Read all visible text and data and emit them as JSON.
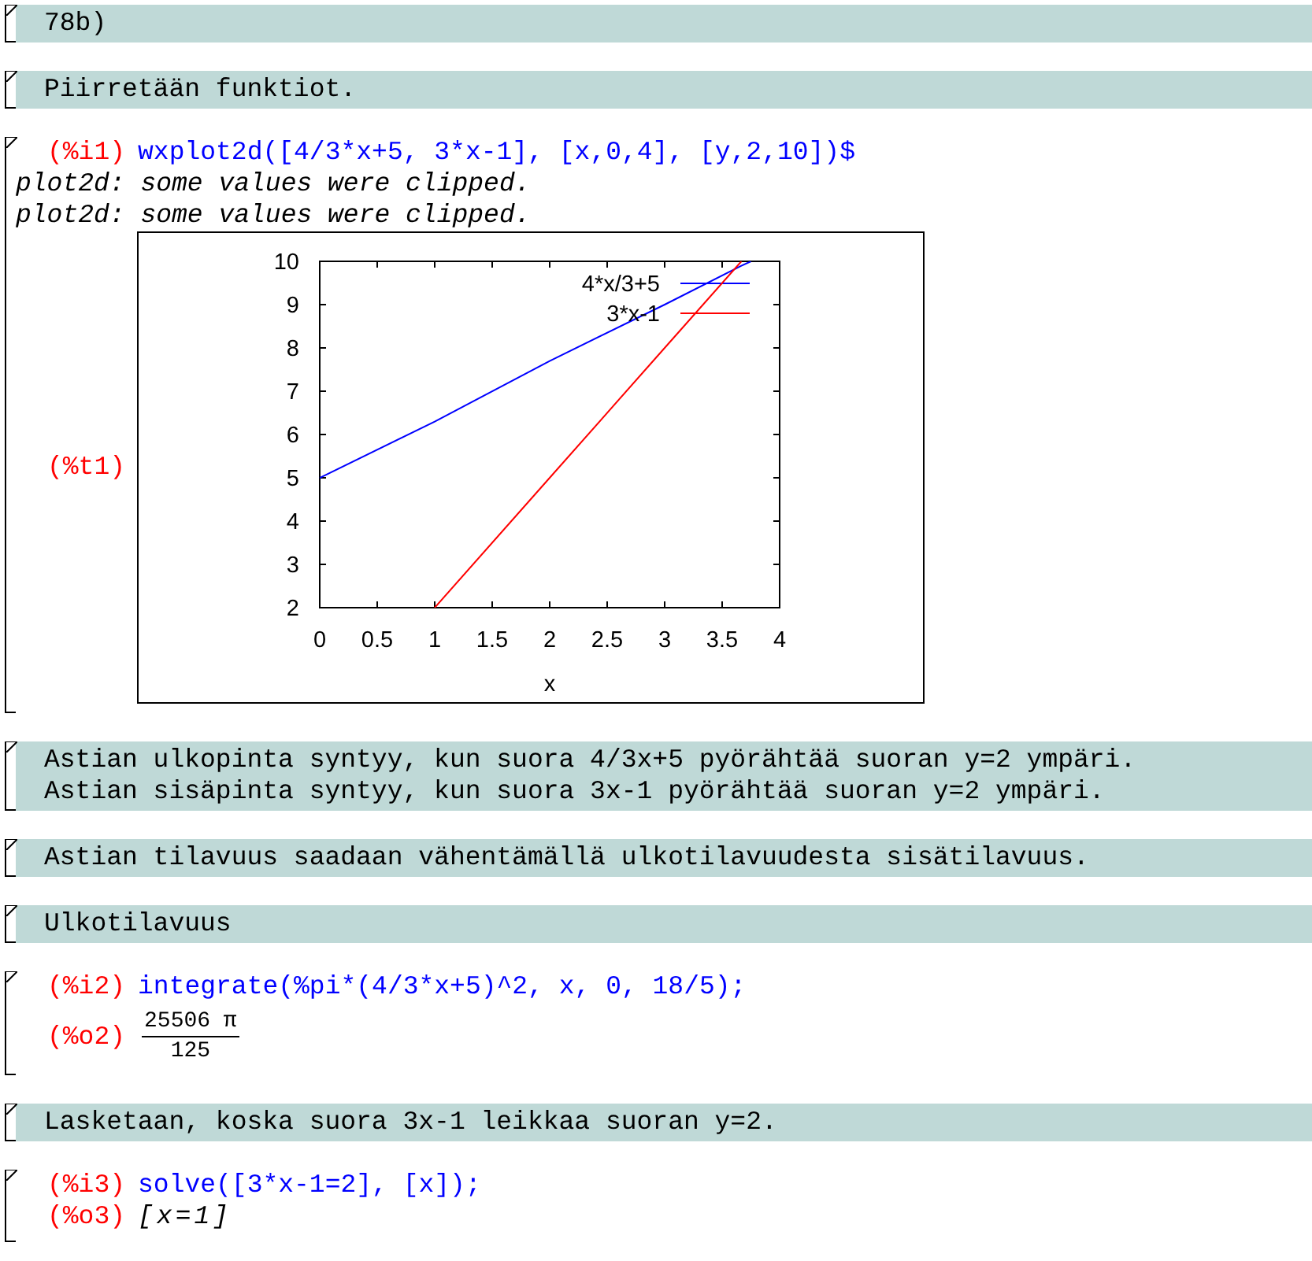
{
  "cells": [
    {
      "kind": "text",
      "lines": [
        "78b)"
      ]
    },
    {
      "kind": "text",
      "lines": [
        "Piirretään funktiot."
      ]
    },
    {
      "kind": "code",
      "label": "(%i1)",
      "input": "wxplot2d([4/3*x+5, 3*x-1], [x,0,4], [y,2,10])$",
      "outputs": [
        {
          "kind": "message",
          "text": "plot2d: some values were clipped."
        },
        {
          "kind": "message",
          "text": "plot2d: some values were clipped."
        },
        {
          "kind": "plot",
          "label": "(%t1)",
          "chart_data": {
            "type": "line",
            "legend": "top right",
            "xlabel": "x",
            "x": [
              0,
              1,
              2,
              3,
              3.667,
              3.75
            ],
            "xlim": [
              0,
              4
            ],
            "ylim": [
              2,
              10
            ],
            "xticks": [
              0,
              0.5,
              1,
              1.5,
              2,
              2.5,
              3,
              3.5,
              4
            ],
            "yticks": [
              2,
              3,
              4,
              5,
              6,
              7,
              8,
              9,
              10
            ],
            "series": [
              {
                "name": "4*x/3+5",
                "color": "#0000ff",
                "values": [
                  5,
                  6.3,
                  7.7,
                  9,
                  9.9,
                  10
                ]
              },
              {
                "name": "3*x-1",
                "color": "#ff0000",
                "values": [
                  null,
                  2,
                  5,
                  8,
                  10,
                  null
                ]
              }
            ]
          }
        }
      ]
    },
    {
      "kind": "text",
      "lines": [
        "Astian ulkopinta syntyy, kun suora 4/3x+5 pyörähtää suoran y=2 ympäri.",
        "Astian sisäpinta syntyy, kun suora 3x-1 pyörähtää suoran y=2 ympäri."
      ]
    },
    {
      "kind": "text",
      "lines": [
        "Astian tilavuus saadaan vähentämällä ulkotilavuudesta sisätilavuus."
      ]
    },
    {
      "kind": "text",
      "lines": [
        "Ulkotilavuus"
      ]
    },
    {
      "kind": "code",
      "label": "(%i2)",
      "input": "integrate(%pi*(4/3*x+5)^2, x, 0, 18/5);",
      "outputs": [
        {
          "kind": "fraction",
          "label": "(%o2)",
          "numerator": "25506 π",
          "denominator": "125"
        }
      ]
    },
    {
      "kind": "text",
      "lines": [
        "Lasketaan, koska suora 3x-1 leikkaa suoran y=2."
      ]
    },
    {
      "kind": "code",
      "label": "(%i3)",
      "input": "solve([3*x-1=2], [x]);",
      "outputs": [
        {
          "kind": "math",
          "label": "(%o3)",
          "text": "[x=1]"
        }
      ]
    }
  ]
}
